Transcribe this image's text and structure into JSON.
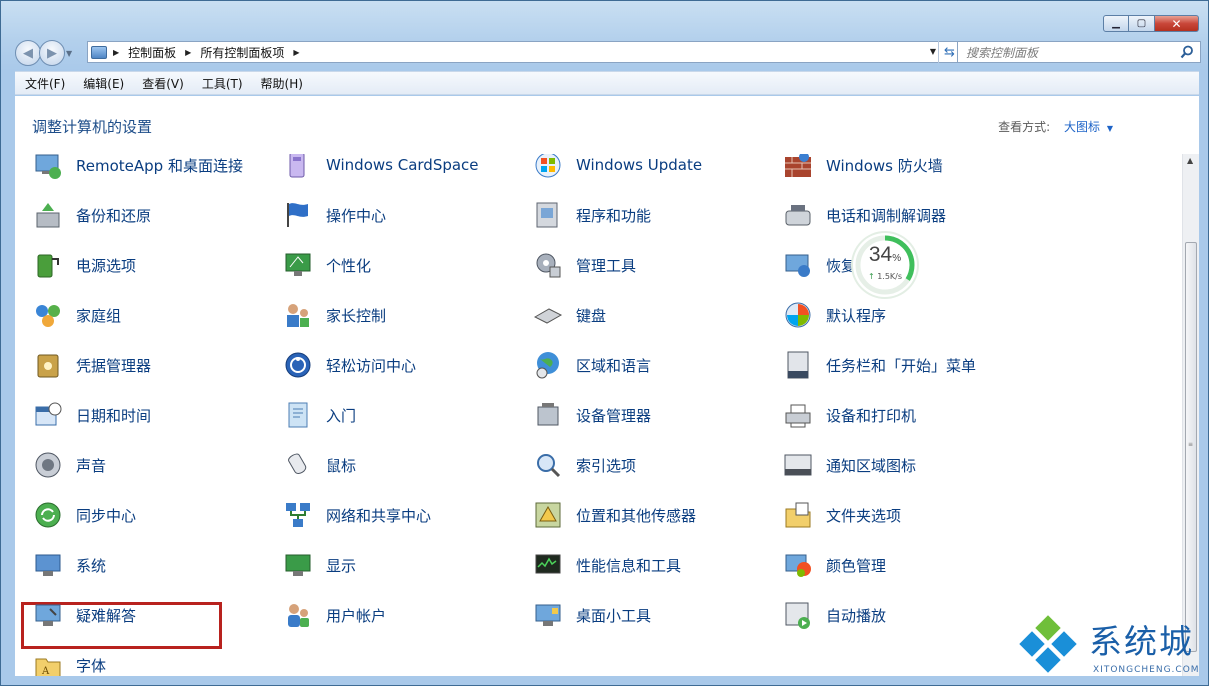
{
  "breadcrumb": [
    "控制面板",
    "所有控制面板项"
  ],
  "search": {
    "placeholder": "搜索控制面板"
  },
  "menu": [
    "文件(F)",
    "编辑(E)",
    "查看(V)",
    "工具(T)",
    "帮助(H)"
  ],
  "content": {
    "heading": "调整计算机的设置",
    "view_by_label": "查看方式:",
    "view_by_value": "大图标"
  },
  "items": [
    [
      "RemoteApp 和桌面连接",
      "Windows CardSpace",
      "Windows Update",
      "Windows 防火墙"
    ],
    [
      "备份和还原",
      "操作中心",
      "程序和功能",
      "电话和调制解调器"
    ],
    [
      "电源选项",
      "个性化",
      "管理工具",
      "恢复"
    ],
    [
      "家庭组",
      "家长控制",
      "键盘",
      "默认程序"
    ],
    [
      "凭据管理器",
      "轻松访问中心",
      "区域和语言",
      "任务栏和「开始」菜单"
    ],
    [
      "日期和时间",
      "入门",
      "设备管理器",
      "设备和打印机"
    ],
    [
      "声音",
      "鼠标",
      "索引选项",
      "通知区域图标"
    ],
    [
      "同步中心",
      "网络和共享中心",
      "位置和其他传感器",
      "文件夹选项"
    ],
    [
      "系统",
      "显示",
      "性能信息和工具",
      "颜色管理"
    ],
    [
      "疑难解答",
      "用户帐户",
      "桌面小工具",
      "自动播放"
    ],
    [
      "字体",
      "",
      "",
      ""
    ]
  ],
  "icons": [
    [
      "remote-desktop-icon",
      "cardspace-icon",
      "windows-update-icon",
      "firewall-icon"
    ],
    [
      "backup-icon",
      "action-center-flag-icon",
      "programs-icon",
      "phone-modem-icon"
    ],
    [
      "power-battery-icon",
      "personalize-monitor-icon",
      "admin-tools-icon",
      "recovery-icon"
    ],
    [
      "homegroup-icon",
      "parental-controls-icon",
      "keyboard-icon",
      "default-programs-icon"
    ],
    [
      "credential-vault-icon",
      "ease-of-access-icon",
      "region-globe-icon",
      "taskbar-icon"
    ],
    [
      "calendar-clock-icon",
      "getting-started-icon",
      "device-manager-icon",
      "printer-icon"
    ],
    [
      "speaker-icon",
      "mouse-icon",
      "indexing-icon",
      "notification-area-icon"
    ],
    [
      "sync-center-icon",
      "network-icon",
      "location-sensor-icon",
      "folder-options-icon"
    ],
    [
      "system-computer-icon",
      "display-icon",
      "performance-icon",
      "color-management-icon"
    ],
    [
      "troubleshooting-icon",
      "user-accounts-icon",
      "gadgets-icon",
      "autoplay-icon"
    ],
    [
      "fonts-folder-icon",
      "",
      "",
      ""
    ]
  ],
  "network_widget": {
    "percent": "34",
    "percent_unit": "%",
    "speed": "1.5K/s",
    "usage_fraction": 0.34
  },
  "watermark": {
    "title": "系统城",
    "subtitle": "XITONGCHENG.COM"
  },
  "colors": {
    "link_text": "#0a3d80",
    "highlight_border": "#b8221e",
    "heading": "#1e4e8a"
  }
}
